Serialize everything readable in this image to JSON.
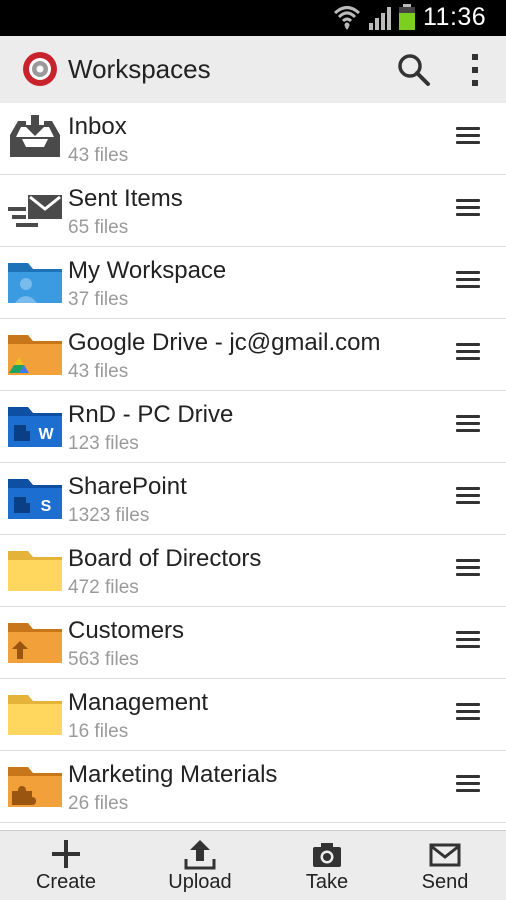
{
  "status_bar": {
    "time": "11:36"
  },
  "action_bar": {
    "title": "Workspaces"
  },
  "workspaces": [
    {
      "name": "Inbox",
      "count": "43 files",
      "icon": "inbox-tray-icon"
    },
    {
      "name": "Sent Items",
      "count": "65 files",
      "icon": "sent-envelope-icon"
    },
    {
      "name": "My Workspace",
      "count": "37 files",
      "icon": "user-folder-icon"
    },
    {
      "name": "Google Drive - jc@gmail.com",
      "count": "43  files",
      "icon": "google-drive-folder-icon"
    },
    {
      "name": "RnD - PC Drive",
      "count": "123 files",
      "icon": "word-folder-icon"
    },
    {
      "name": "SharePoint",
      "count": "1323 files",
      "icon": "sharepoint-folder-icon"
    },
    {
      "name": "Board of Directors",
      "count": "472 files",
      "icon": "folder-icon"
    },
    {
      "name": "Customers",
      "count": "563 files",
      "icon": "upload-folder-icon"
    },
    {
      "name": "Management",
      "count": "16 files",
      "icon": "folder-icon"
    },
    {
      "name": "Marketing Materials",
      "count": "26 files",
      "icon": "puzzle-folder-icon"
    }
  ],
  "bottom_bar": {
    "create": "Create",
    "upload": "Upload",
    "take": "Take",
    "send": "Send"
  }
}
